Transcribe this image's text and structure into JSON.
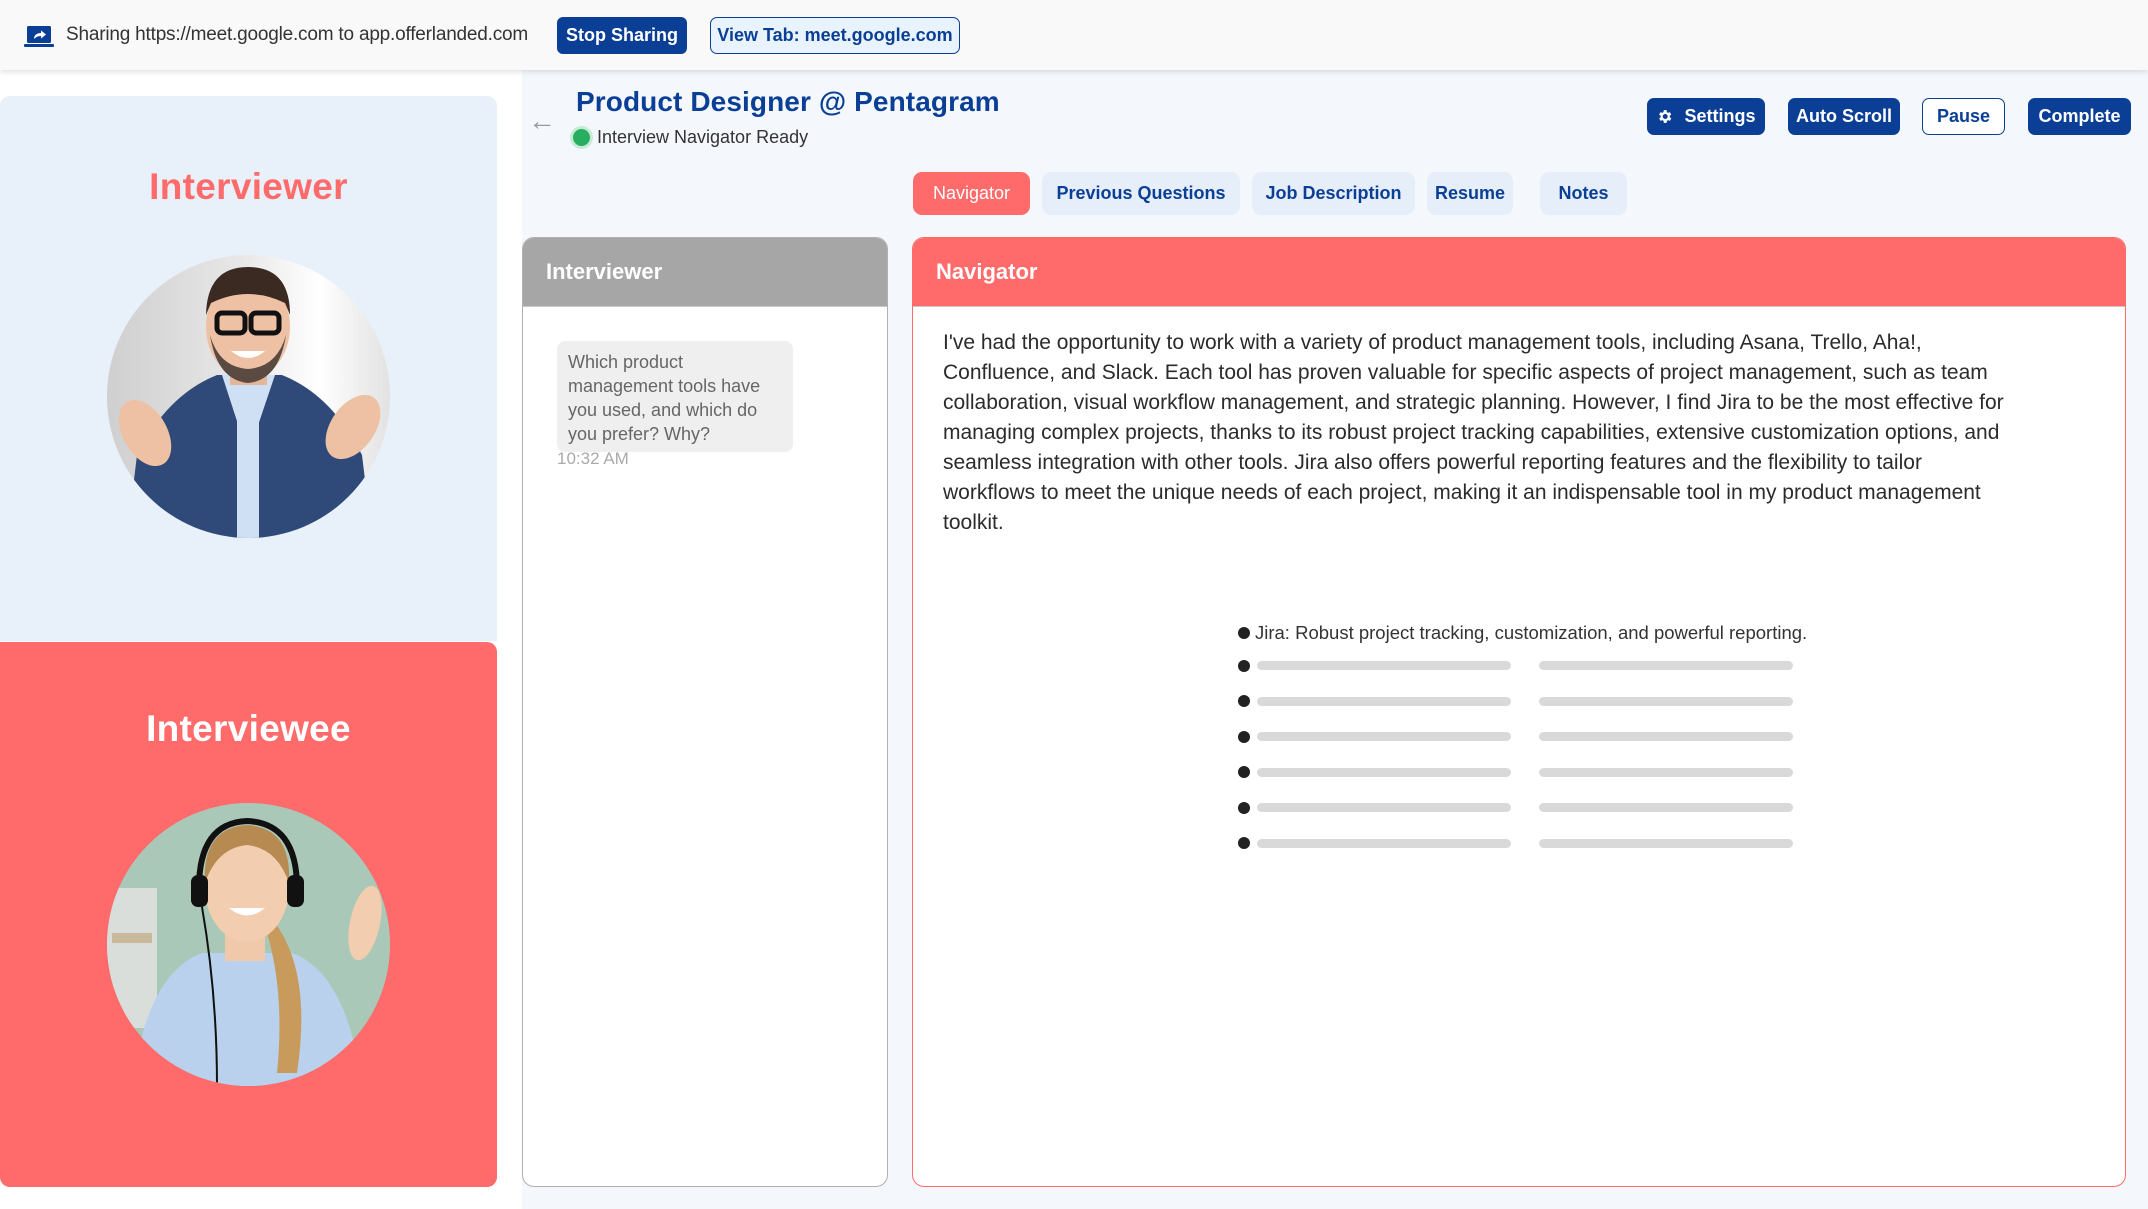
{
  "sharebar": {
    "icon": "screen-share-icon",
    "text": "Sharing https://meet.google.com to app.offerlanded.com",
    "stop_label": "Stop Sharing",
    "view_tab_label": "View Tab: meet.google.com"
  },
  "participants": {
    "interviewer": {
      "title": "Interviewer",
      "avatar": "interviewer-avatar"
    },
    "interviewee": {
      "title": "Interviewee",
      "avatar": "interviewee-avatar"
    }
  },
  "header": {
    "back_icon": "arrow-left-icon",
    "title": "Product Designer @ Pentagram",
    "status": "Interview Navigator Ready",
    "status_color": "#27ae60"
  },
  "actions": {
    "settings": "Settings",
    "auto_scroll": "Auto Scroll",
    "pause": "Pause",
    "complete": "Complete"
  },
  "tabs": [
    {
      "label": "Navigator",
      "active": true
    },
    {
      "label": "Previous Questions",
      "active": false
    },
    {
      "label": "Job Description",
      "active": false
    },
    {
      "label": "Resume",
      "active": false
    },
    {
      "label": "Notes",
      "active": false
    }
  ],
  "chat": {
    "header": "Interviewer",
    "messages": [
      {
        "text": "Which product management tools have you used, and which do you prefer? Why?",
        "time": "10:32 AM"
      }
    ]
  },
  "navigator": {
    "header": "Navigator",
    "answer": "I've had the opportunity to work with a variety of product management tools, including Asana, Trello, Aha!, Confluence, and Slack. Each tool has proven valuable for specific aspects of project management, such as team collaboration, visual workflow management, and strategic planning. However, I find Jira to be the most effective for managing complex projects, thanks to its robust project tracking capabilities, extensive customization options, and seamless integration with other tools. Jira also offers powerful reporting features and the flexibility to tailor workflows to meet the unique needs of each project, making it an indispensable tool in my product management toolkit.",
    "summary_points": [
      "Jira: Robust project tracking, customization, and powerful reporting."
    ],
    "placeholder_rows": 6
  },
  "colors": {
    "brand": "#0b3f96",
    "accent": "#ff6b6b",
    "interviewer_bg": "#e8f0fa",
    "content_bg": "#f4f8fd"
  }
}
